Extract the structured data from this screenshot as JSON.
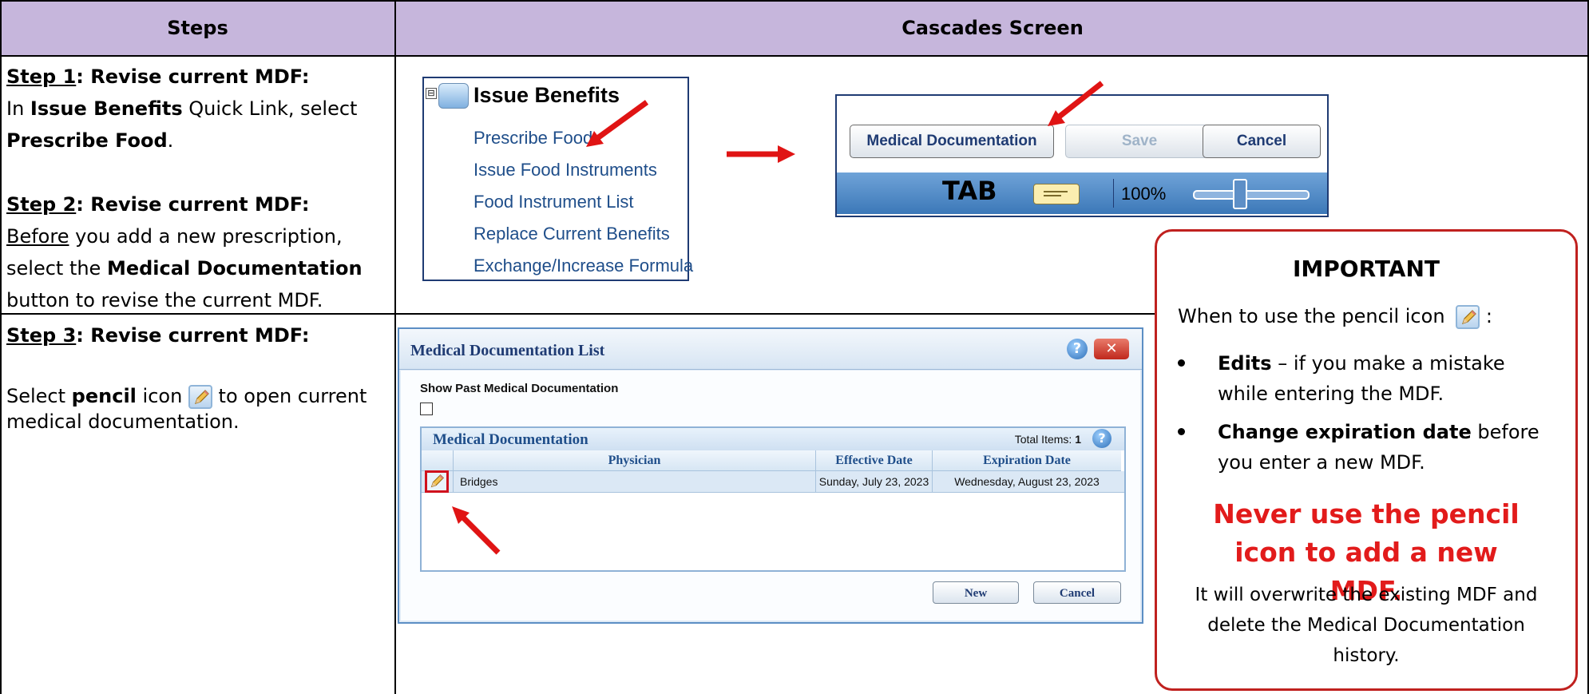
{
  "table": {
    "header": {
      "steps": "Steps",
      "screen": "Cascades Screen"
    }
  },
  "step1": {
    "title_prefix": "Step 1",
    "title_suffix": ": Revise current MDF:",
    "text_in": "In ",
    "text_quicklink": "Issue Benefits",
    "text_mid": " Quick Link, select ",
    "text_target": "Prescribe Food",
    "text_end": "."
  },
  "step2": {
    "title_prefix": "Step 2",
    "title_suffix": ": Revise current MDF:",
    "text_before": "Before",
    "text_mid": " you add a new prescription, select the ",
    "text_target": "Medical Documentation",
    "text_end": " button to revise the current MDF."
  },
  "step3": {
    "title_prefix": "Step 3",
    "title_suffix": ": Revise current MDF:",
    "text_select": "Select ",
    "text_pencil": "pencil",
    "text_icon": " icon ",
    "text_end": " to open current medical documentation."
  },
  "quick_links": {
    "expander": "⊟",
    "title": "Issue Benefits",
    "items": [
      "Prescribe Food",
      "Issue Food Instruments",
      "Food Instrument List",
      "Replace Current Benefits",
      "Exchange/Increase Formula"
    ]
  },
  "toolbar": {
    "medical_documentation": "Medical Documentation",
    "save": "Save",
    "cancel": "Cancel",
    "tab": "TAB",
    "zoom": "100%"
  },
  "important": {
    "title": "IMPORTANT",
    "when_text": "When to use the pencil icon",
    "when_colon": ":",
    "bullets": [
      {
        "bold": "Edits",
        "text": " – if you make a mistake while entering the MDF."
      },
      {
        "bold": "Change expiration date",
        "text": " before you enter a new MDF."
      }
    ],
    "never": "Never use the pencil icon to add a new MDF.",
    "overwrite": "It will overwrite the existing MDF and delete the Medical Documentation history."
  },
  "mdl": {
    "title": "Medical Documentation List",
    "help": "?",
    "close": "✕",
    "show_past": "Show Past Medical Documentation",
    "grid_title": "Medical Documentation",
    "total_label": "Total Items:",
    "total_value": "1",
    "columns": [
      "Physician",
      "Effective Date",
      "Expiration Date"
    ],
    "rows": [
      {
        "physician": "Bridges",
        "effective": "Sunday, July 23, 2023",
        "expiration": "Wednesday, August 23, 2023"
      }
    ],
    "new": "New",
    "cancel": "Cancel"
  },
  "colors": {
    "header_bg": "#c6b6dc",
    "arrow": "#e01414",
    "important_border": "#c0211f",
    "never_text": "#e21b1b",
    "link": "#1f4e8a"
  }
}
